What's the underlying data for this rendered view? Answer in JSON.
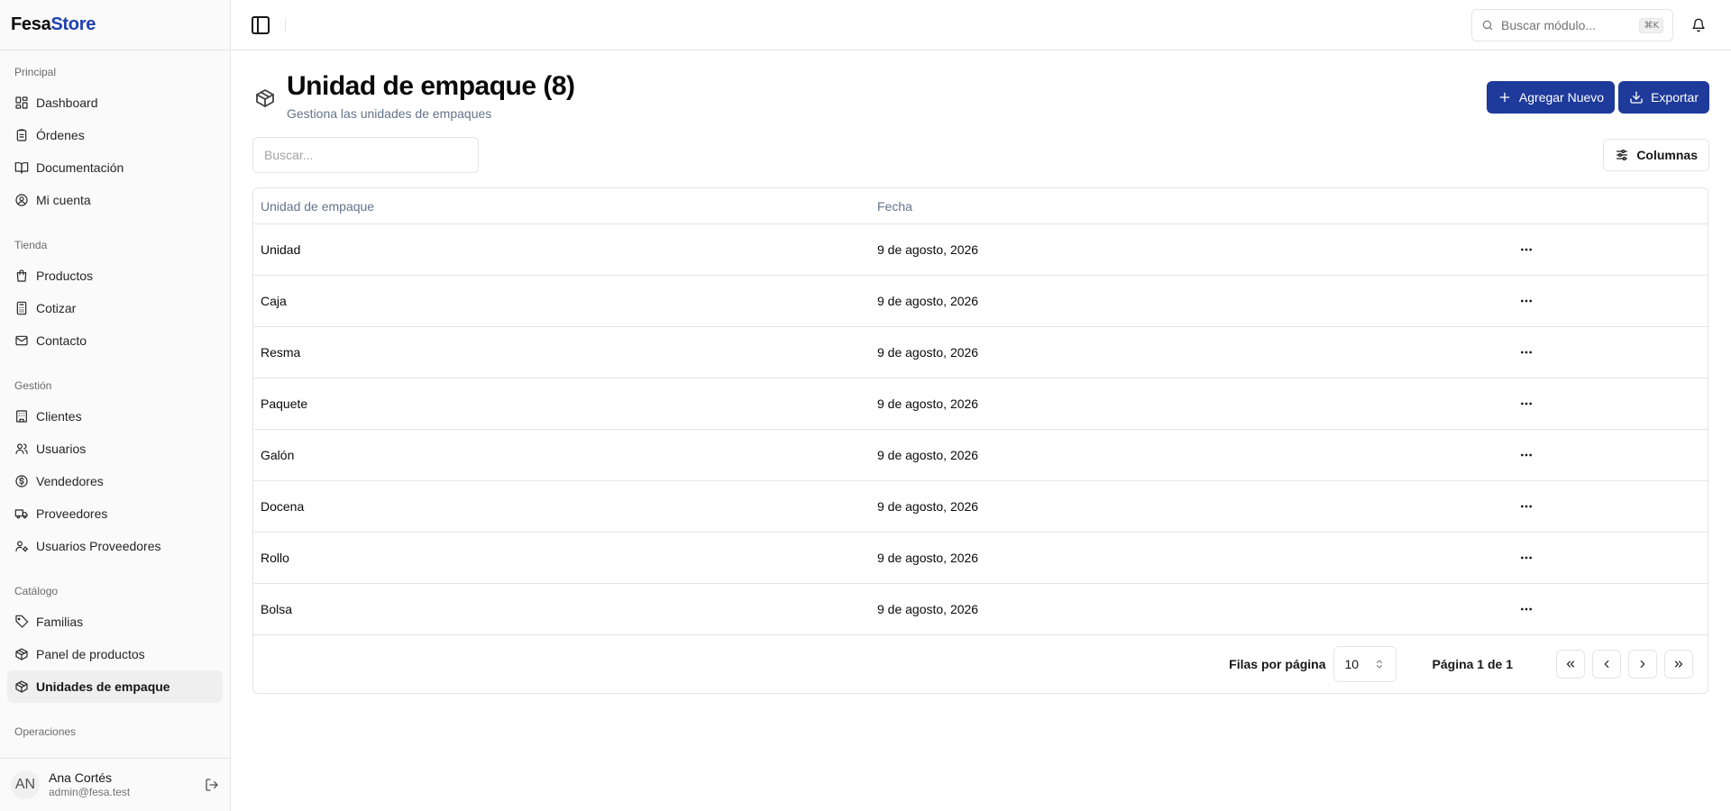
{
  "brand": {
    "part1": "Fesa",
    "part2": "Store"
  },
  "sidebar": {
    "groups": [
      {
        "label": "Principal",
        "items": [
          {
            "label": "Dashboard",
            "icon": "dashboard-icon"
          },
          {
            "label": "Órdenes",
            "icon": "clipboard-icon"
          },
          {
            "label": "Documentación",
            "icon": "book-icon"
          },
          {
            "label": "Mi cuenta",
            "icon": "user-circle-icon"
          }
        ]
      },
      {
        "label": "Tienda",
        "items": [
          {
            "label": "Productos",
            "icon": "shopping-bag-icon"
          },
          {
            "label": "Cotizar",
            "icon": "calculator-icon"
          },
          {
            "label": "Contacto",
            "icon": "mail-icon"
          }
        ]
      },
      {
        "label": "Gestión",
        "items": [
          {
            "label": "Clientes",
            "icon": "building-icon"
          },
          {
            "label": "Usuarios",
            "icon": "users-icon"
          },
          {
            "label": "Vendedores",
            "icon": "dollar-circle-icon"
          },
          {
            "label": "Proveedores",
            "icon": "truck-icon"
          },
          {
            "label": "Usuarios Proveedores",
            "icon": "user-cog-icon"
          }
        ]
      },
      {
        "label": "Catálogo",
        "items": [
          {
            "label": "Familias",
            "icon": "tag-icon"
          },
          {
            "label": "Panel de productos",
            "icon": "package-icon"
          },
          {
            "label": "Unidades de empaque",
            "icon": "package-icon",
            "active": true
          }
        ]
      },
      {
        "label": "Operaciones",
        "items": []
      }
    ]
  },
  "user": {
    "initials": "AN",
    "name": "Ana Cortés",
    "email": "admin@fesa.test"
  },
  "topbar": {
    "search_placeholder": "Buscar módulo...",
    "shortcut": "⌘K"
  },
  "page": {
    "title": "Unidad de empaque (8)",
    "subtitle": "Gestiona las unidades de empaques",
    "add_label": "Agregar Nuevo",
    "export_label": "Exportar",
    "search_placeholder": "Buscar...",
    "columns_label": "Columnas"
  },
  "table": {
    "headers": [
      "Unidad de empaque",
      "Fecha"
    ],
    "rows": [
      {
        "name": "Unidad",
        "date": "9 de agosto, 2026"
      },
      {
        "name": "Caja",
        "date": "9 de agosto, 2026"
      },
      {
        "name": "Resma",
        "date": "9 de agosto, 2026"
      },
      {
        "name": "Paquete",
        "date": "9 de agosto, 2026"
      },
      {
        "name": "Galón",
        "date": "9 de agosto, 2026"
      },
      {
        "name": "Docena",
        "date": "9 de agosto, 2026"
      },
      {
        "name": "Rollo",
        "date": "9 de agosto, 2026"
      },
      {
        "name": "Bolsa",
        "date": "9 de agosto, 2026"
      }
    ]
  },
  "pagination": {
    "rows_label": "Filas por página",
    "rows_value": "10",
    "page_label": "Página 1 de 1"
  },
  "colors": {
    "primary": "#1e3a9a",
    "brand_accent": "#1e40af",
    "muted": "#64748b"
  }
}
